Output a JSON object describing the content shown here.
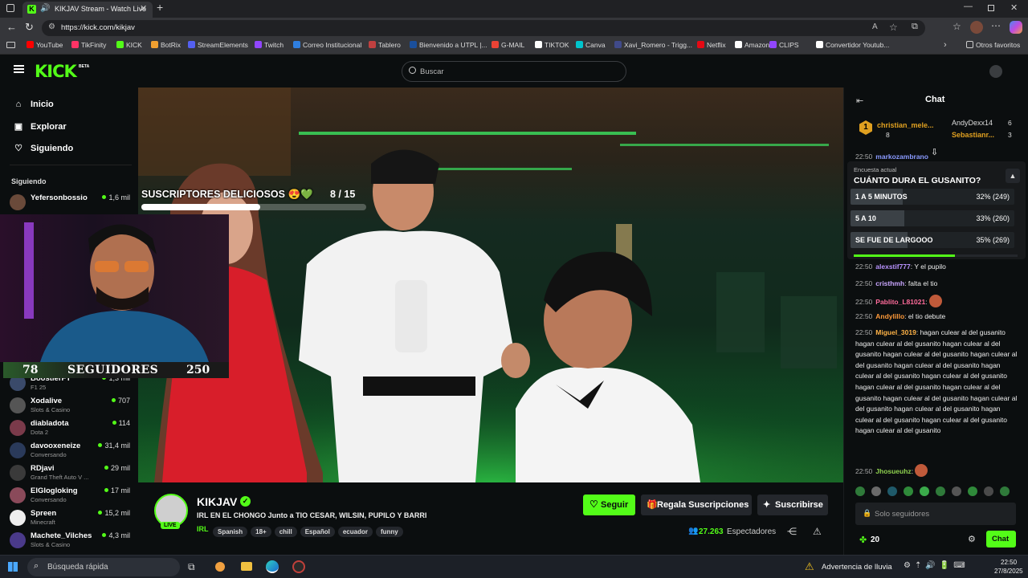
{
  "browser": {
    "tab_title": "KIKJAV Stream - Watch Live",
    "url": "https://kick.com/kikjav",
    "bookmarks": [
      {
        "label": "YouTube",
        "color": "#ff0000"
      },
      {
        "label": "TikFinity",
        "color": "#ff3366"
      },
      {
        "label": "KICK",
        "color": "#53fc18"
      },
      {
        "label": "BotRix",
        "color": "#f0a030"
      },
      {
        "label": "StreamElements",
        "color": "#5460f0"
      },
      {
        "label": "Twitch",
        "color": "#9146ff"
      },
      {
        "label": "Correo Institucional",
        "color": "#2f7fe0"
      },
      {
        "label": "Tablero",
        "color": "#c04040"
      },
      {
        "label": "Bienvenido a UTPL |...",
        "color": "#1a4f9c"
      },
      {
        "label": "G-MAIL",
        "color": "#ea4335"
      },
      {
        "label": "TIKTOK",
        "color": "#ffffff"
      },
      {
        "label": "Canva",
        "color": "#00c4cc"
      },
      {
        "label": "Xavi_Romero - Trigg...",
        "color": "#404a8a"
      },
      {
        "label": "Netflix",
        "color": "#e50914"
      },
      {
        "label": "Amazon",
        "color": "#ffffff"
      },
      {
        "label": "CLIPS",
        "color": "#9146ff"
      },
      {
        "label": "Convertidor Youtub...",
        "color": "#ffffff"
      }
    ],
    "other_bookmarks": "Otros favoritos"
  },
  "header": {
    "logo": "KICK",
    "logo_badge": "BETA",
    "search_placeholder": "Buscar"
  },
  "sidebar": {
    "nav": [
      {
        "label": "Inicio",
        "icon": "home-icon"
      },
      {
        "label": "Explorar",
        "icon": "explore-icon"
      },
      {
        "label": "Siguiendo",
        "icon": "heart-icon"
      }
    ],
    "section_title": "Siguiendo",
    "following": [
      {
        "name": "Yefersonbossio",
        "category": "",
        "viewers": "1,6 mil",
        "color": "#6a4a3a"
      },
      {
        "name": "BoostierFT",
        "category": "F1 25",
        "viewers": "1,3 mil",
        "color": "#3a4a6a"
      },
      {
        "name": "Xodalive",
        "category": "Slots & Casino",
        "viewers": "707",
        "color": "#555"
      },
      {
        "name": "diabladota",
        "category": "Dota 2",
        "viewers": "114",
        "color": "#7a3a4a"
      },
      {
        "name": "davooxeneize",
        "category": "Conversando",
        "viewers": "31,4 mil",
        "color": "#2a3a5a"
      },
      {
        "name": "RDjavi",
        "category": "Grand Theft Auto V ...",
        "viewers": "29 mil",
        "color": "#3a3a3a"
      },
      {
        "name": "ElGlogloking",
        "category": "Conversando",
        "viewers": "17 mil",
        "color": "#8a4a5a"
      },
      {
        "name": "Spreen",
        "category": "Minecraft",
        "viewers": "15,2 mil",
        "color": "#eee"
      },
      {
        "name": "Machete_Vilches",
        "category": "Slots & Casino",
        "viewers": "4,3 mil",
        "color": "#4a3a8a"
      }
    ]
  },
  "overlay": {
    "subs_label": "SUSCRIPTORES DELICIOSOS 😍💚",
    "subs_progress": "8 / 15",
    "subs_fraction": 0.53,
    "followers_current": "78",
    "followers_label": "SEGUIDORES",
    "followers_goal": "250"
  },
  "channel": {
    "name": "KIKJAV",
    "live_badge": "LIVE",
    "title": "IRL EN EL CHONGO Junto a TIO CESAR, WILSIN, PUPILO Y BARRI",
    "category": "IRL",
    "tags": [
      "Spanish",
      "18+",
      "chill",
      "Español",
      "ecuador",
      "funny"
    ],
    "follow_label": "Seguir",
    "gift_label": "Regala Suscripciones",
    "subscribe_label": "Suscribirse",
    "viewers": "27.263",
    "viewers_label": "Espectadores"
  },
  "chat": {
    "title": "Chat",
    "leaderboard": [
      {
        "rank": "1",
        "name": "christian_mele...",
        "count": "8"
      },
      {
        "name": "AndyDexx14",
        "count": "6"
      },
      {
        "name": "Sebastianr...",
        "count": "3"
      }
    ],
    "peek_message": {
      "time": "22:50",
      "user": "markozambrano"
    },
    "poll": {
      "label": "Encuesta actual",
      "question": "CUÁNTO DURA EL GUSANITO?",
      "options": [
        {
          "label": "1 A 5 MINUTOS",
          "result": "32% (249)",
          "fraction": 0.32
        },
        {
          "label": "5 A 10",
          "result": "33% (260)",
          "fraction": 0.33
        },
        {
          "label": "SE FUE DE LARGOOO",
          "result": "35% (269)",
          "fraction": 0.35
        }
      ],
      "time_remaining_fraction": 0.62
    },
    "messages": [
      {
        "time": "22:50",
        "user": "alexstif777",
        "color": "#b993ff",
        "text": "Y el pupilo"
      },
      {
        "time": "22:50",
        "user": "cristhmh",
        "color": "#c9a6ff",
        "text": "falta el tio"
      },
      {
        "time": "22:50",
        "user": "Pablito_L81021",
        "color": "#ff6b9a",
        "text": ""
      },
      {
        "time": "22:50",
        "user": "Andylillo",
        "color": "#ff9a3a",
        "text": "el tio debute"
      },
      {
        "time": "22:50",
        "user": "Miguel_3019",
        "color": "#ffb347",
        "text": "hagan culear al del gusanito hagan culear al del gusanito hagan culear al del gusanito hagan culear al del gusanito hagan culear al del gusanito hagan culear al del gusanito hagan culear al del gusanito hagan culear al del gusanito hagan culear al del gusanito hagan culear al del gusanito hagan culear al del gusanito hagan culear al del gusanito hagan culear al del gusanito hagan culear al del gusanito hagan culear al del gusanito hagan culear al del gusanito"
      },
      {
        "time": "22:50",
        "user": "Jhosueuhz",
        "color": "#8fd14f",
        "text": ""
      }
    ],
    "input_placeholder": "Solo seguidores",
    "points": "20",
    "send_label": "Chat"
  },
  "taskbar": {
    "search_placeholder": "Búsqueda rápida",
    "weather": "Advertencia de lluvia",
    "time": "22:50",
    "date": "27/8/2025"
  },
  "colors": {
    "kick_green": "#53fc18",
    "background": "#0b0e0f"
  }
}
